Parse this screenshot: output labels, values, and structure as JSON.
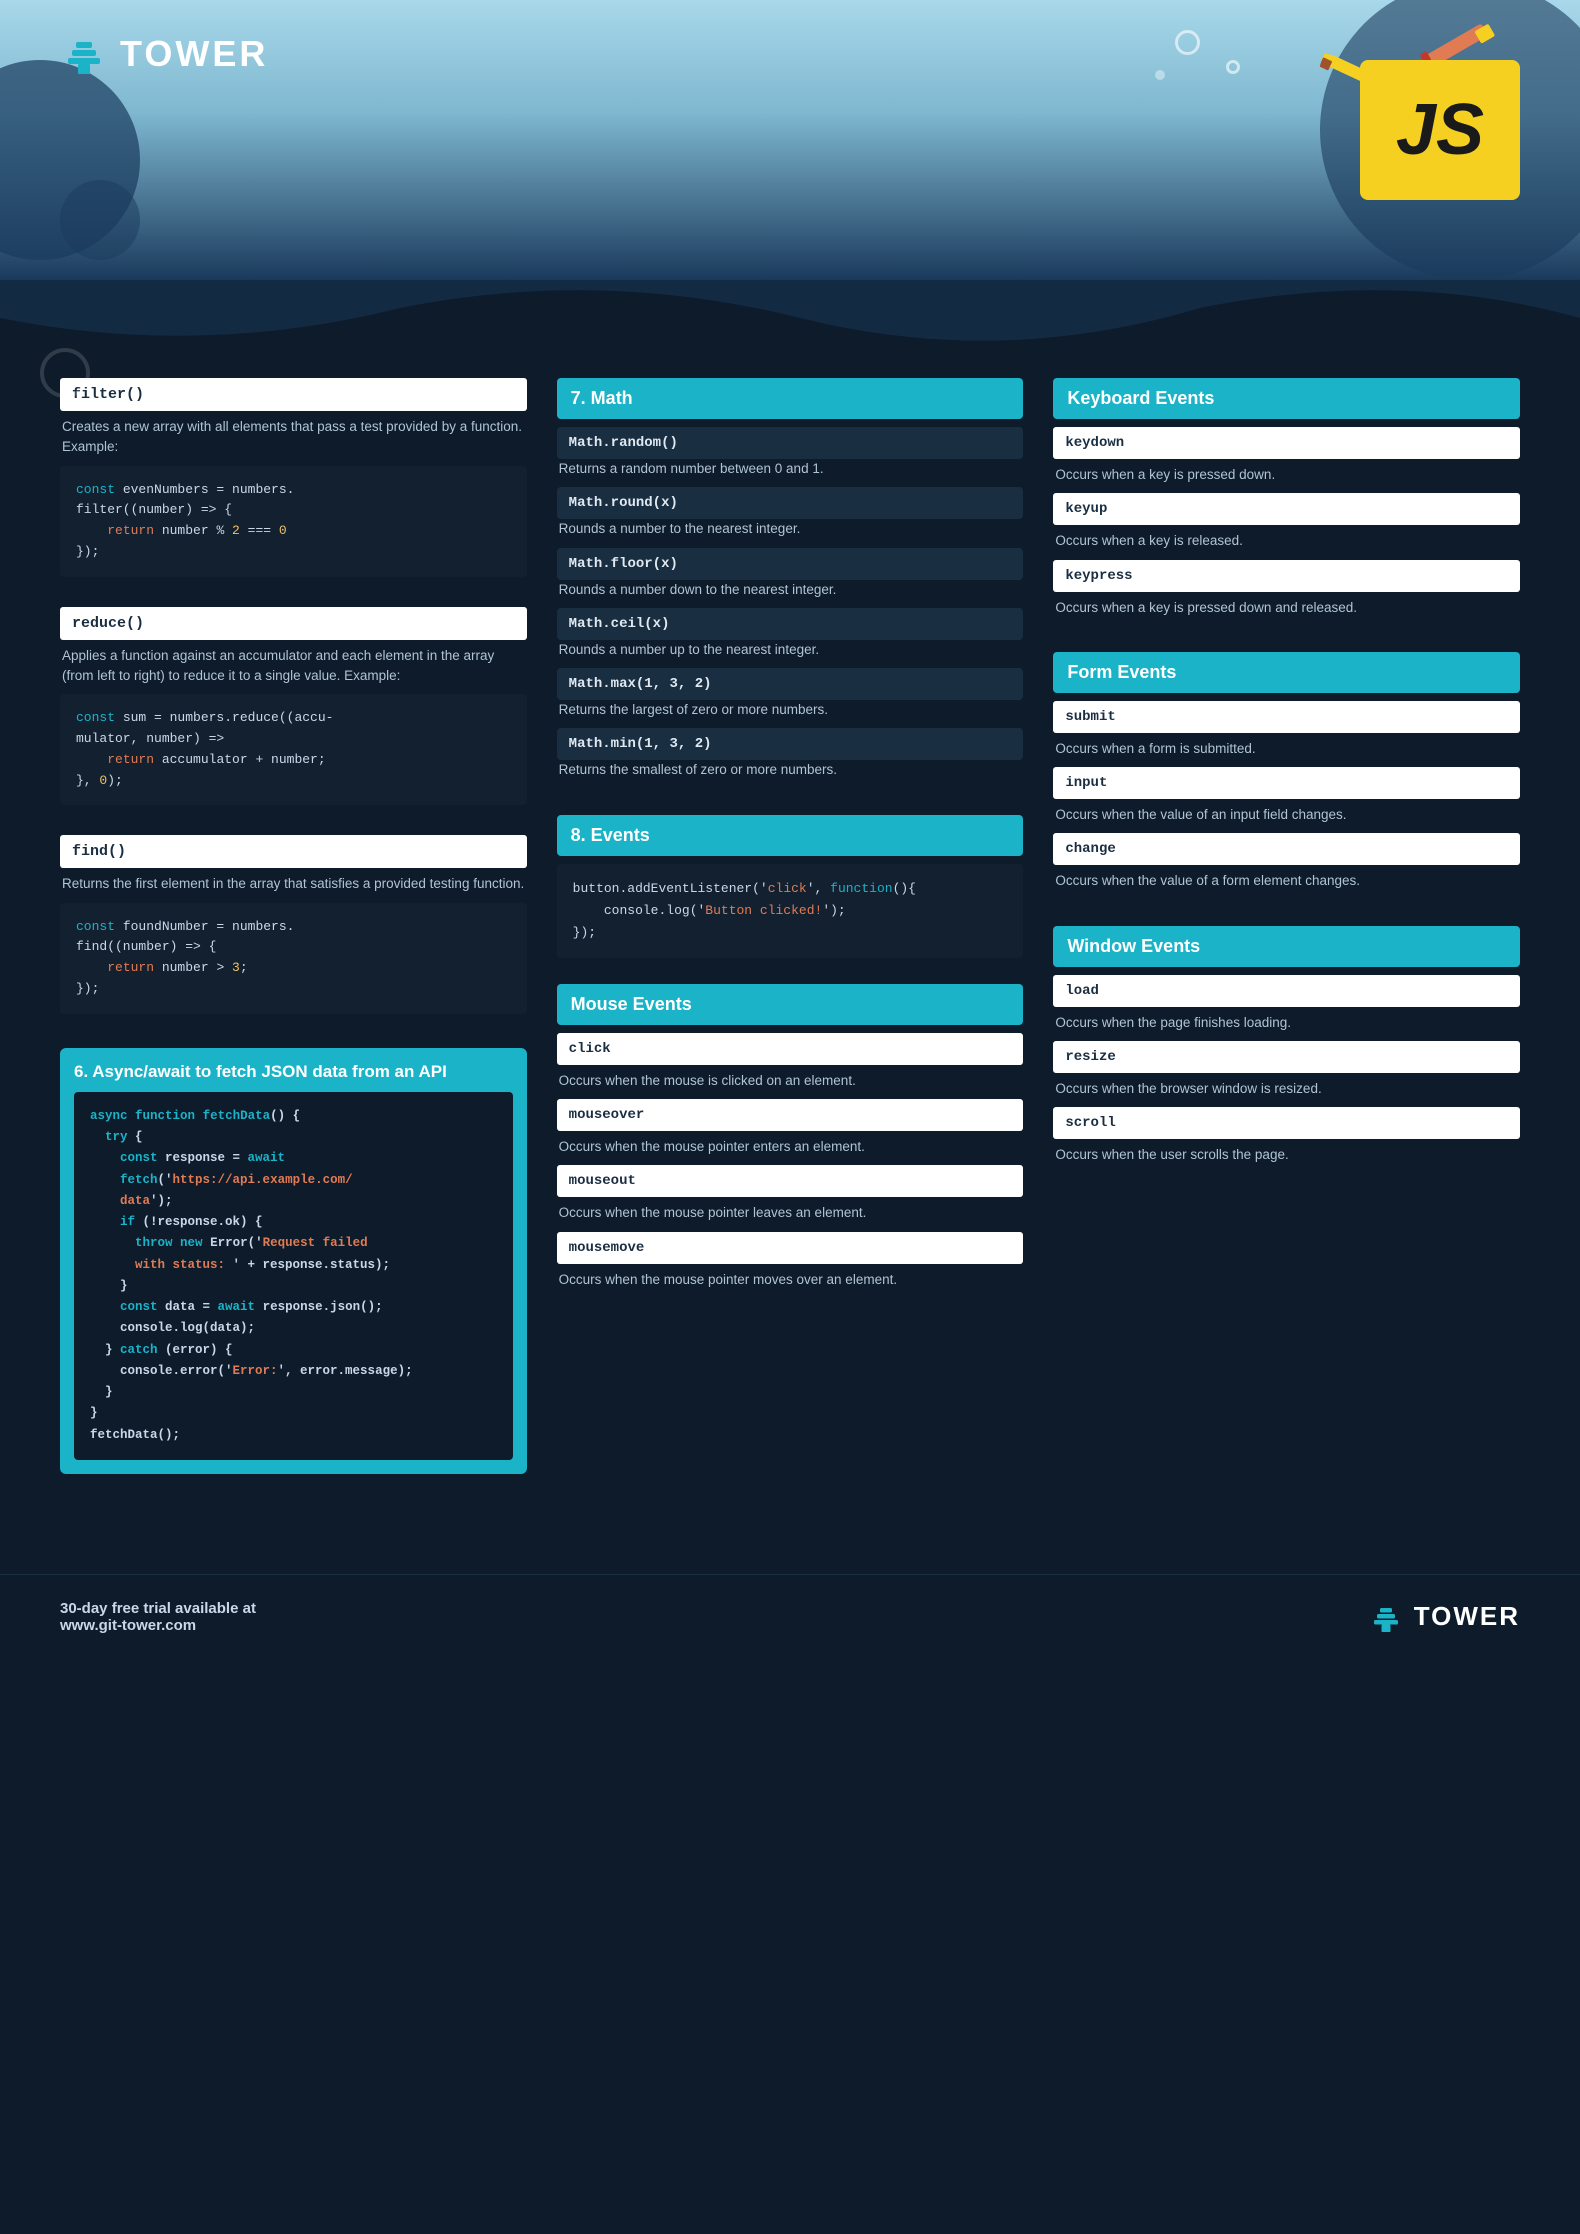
{
  "header": {
    "logo_text": "TOWER",
    "js_label": "JS"
  },
  "left_column": {
    "filter": {
      "title": "filter()",
      "description": "Creates a new array with all elements that pass a test provided by a function. Example:",
      "code": [
        "const evenNumbers = numbers.",
        "filter((number) => {",
        "    return number % 2 === 0",
        "});"
      ]
    },
    "reduce": {
      "title": "reduce()",
      "description": "Applies a function against an accumulator and each element in the array (from left to right) to reduce it to a single value. Example:",
      "code": [
        "const sum = numbers.reduce((accu-",
        "mulator, number) =>",
        "    return accumulator + number;",
        "}, 0);"
      ]
    },
    "find": {
      "title": "find()",
      "description": "Returns the first element in the array that satisfies a provided testing function.",
      "code": [
        "const foundNumber = numbers.",
        "find((number) => {",
        "    return number > 3;",
        "});"
      ]
    },
    "async": {
      "title": "6. Async/await to fetch JSON data from an API",
      "code_lines": [
        "async function fetchData() {",
        "  try {",
        "    const response = await",
        "    fetch('https://api.example.com/",
        "    data');",
        "    if (!response.ok) {",
        "      throw new Error('Request failed",
        "      with status: ' + response.status);",
        "    }",
        "    const data = await response.json();",
        "    console.log(data);",
        "  } catch (error) {",
        "    console.error('Error:', error.message);",
        "  }",
        "}",
        "fetchData();"
      ]
    }
  },
  "middle_column": {
    "math": {
      "title": "7. Math",
      "methods": [
        {
          "name": "Math.random()",
          "desc": "Returns a random number between 0 and 1."
        },
        {
          "name": "Math.round(x)",
          "desc": "Rounds a number to the nearest integer."
        },
        {
          "name": "Math.floor(x)",
          "desc": "Rounds a number down to the nearest integer."
        },
        {
          "name": "Math.ceil(x)",
          "desc": "Rounds a number up to the nearest integer."
        },
        {
          "name": "Math.max(1, 3, 2)",
          "desc": "Returns the largest of zero or more numbers."
        },
        {
          "name": "Math.min(1, 3, 2)",
          "desc": "Returns the smallest of zero or more numbers."
        }
      ]
    },
    "events": {
      "title": "8. Events",
      "code_line1": "button.addEventListener('click', function(){",
      "code_line2": "    console.log('Button clicked!');",
      "code_line3": "});"
    },
    "mouse_events": {
      "title": "Mouse Events",
      "items": [
        {
          "name": "click",
          "desc": "Occurs when the mouse is clicked on an element."
        },
        {
          "name": "mouseover",
          "desc": "Occurs when the mouse pointer enters an element."
        },
        {
          "name": "mouseout",
          "desc": "Occurs when the mouse pointer leaves an element."
        },
        {
          "name": "mousemove",
          "desc": "Occurs when the mouse pointer moves over an element."
        }
      ]
    }
  },
  "right_column": {
    "keyboard_events": {
      "title": "Keyboard Events",
      "items": [
        {
          "name": "keydown",
          "desc": "Occurs when a key is pressed down."
        },
        {
          "name": "keyup",
          "desc": "Occurs when a key is released."
        },
        {
          "name": "keypress",
          "desc": "Occurs when a key is pressed down and released."
        }
      ]
    },
    "form_events": {
      "title": "Form Events",
      "items": [
        {
          "name": "submit",
          "desc": "Occurs when a form is submitted."
        },
        {
          "name": "input",
          "desc": "Occurs when the value of an input field changes."
        },
        {
          "name": "change",
          "desc": "Occurs when the value of a form element changes."
        }
      ]
    },
    "window_events": {
      "title": "Window Events",
      "items": [
        {
          "name": "load",
          "desc": "Occurs when the page finishes loading."
        },
        {
          "name": "resize",
          "desc": "Occurs when the browser window is resized."
        },
        {
          "name": "scroll",
          "desc": "Occurs when the user scrolls the page."
        }
      ]
    }
  },
  "footer": {
    "text_line1": "30-day free trial available at",
    "text_line2": "www.git-tower.com",
    "logo_text": "TOWER"
  }
}
